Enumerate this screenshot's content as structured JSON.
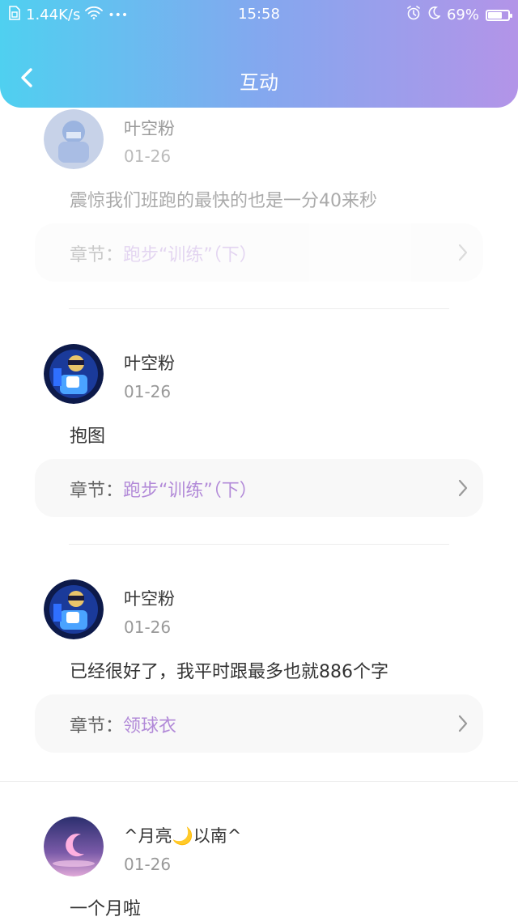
{
  "status_bar": {
    "speed": "1.44K/s",
    "dots": "•••",
    "time": "15:58",
    "battery": "69%",
    "battery_level": 0.69
  },
  "header": {
    "title": "互动"
  },
  "comments": [
    {
      "name": "叶空粉",
      "date": "01-26",
      "text": "震惊我们班跑的最快的也是一分40来秒",
      "chapter_label": "章节：",
      "chapter_title": "跑步“训练”（下）"
    },
    {
      "name": "叶空粉",
      "date": "01-26",
      "text": "抱图",
      "chapter_label": "章节：",
      "chapter_title": "跑步“训练”（下）"
    },
    {
      "name": "叶空粉",
      "date": "01-26",
      "text": "已经很好了，我平时跟最多也就886个字",
      "chapter_label": "章节：",
      "chapter_title": "领球衣"
    },
    {
      "name": "^月亮🌙以南^",
      "date": "01-26",
      "text": "一个月啦"
    }
  ],
  "colors": {
    "accent": "#b28ad8",
    "gradient_start": "#4fd0f0",
    "gradient_end": "#b394e8"
  }
}
